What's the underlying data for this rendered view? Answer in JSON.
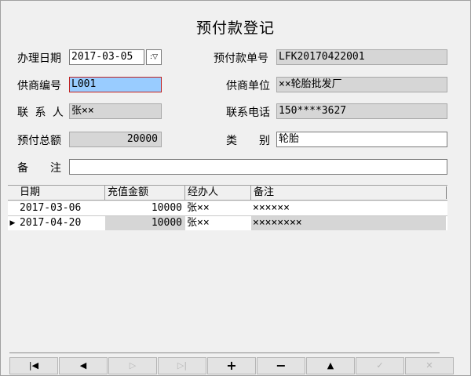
{
  "title": "预付款登记",
  "form": {
    "date_label": "办理日期",
    "date_value": "2017-03-05",
    "date_dropdown_glyph": ":",
    "prepay_no_label": "预付款单号",
    "prepay_no_value": "LFK20170422001",
    "supplier_code_label": "供商编号",
    "supplier_code_value": "L001",
    "supplier_unit_label": "供商单位",
    "supplier_unit_value": "××轮胎批发厂",
    "contact_label": "联 系 人",
    "contact_value": "张××",
    "phone_label": "联系电话",
    "phone_value": "150****3627",
    "total_label": "预付总额",
    "total_value": "20000",
    "category_label": "类　　别",
    "category_value": "轮胎",
    "remark_label": "备　　注",
    "remark_value": ""
  },
  "table": {
    "headers": [
      "日期",
      "充值金额",
      "经办人",
      "备注"
    ],
    "rows": [
      {
        "date": "2017-03-06",
        "amount": "10000",
        "handler": "张××",
        "note": "××××××",
        "current": false
      },
      {
        "date": "2017-04-20",
        "amount": "10000",
        "handler": "张××",
        "note": "××××××××",
        "current": true
      }
    ]
  },
  "nav": {
    "first_icon": "first-record-icon",
    "prev_icon": "previous-record-icon",
    "next_icon": "next-record-icon",
    "last_icon": "last-record-icon",
    "add_icon": "add-icon",
    "delete_icon": "delete-icon",
    "up_icon": "up-icon",
    "save_icon": "checkmark-icon",
    "cancel_icon": "cancel-icon"
  },
  "colors": {
    "window_bg": "#f0f0f0",
    "readonly_bg": "#d6d6d6",
    "focused_field_bg": "#99ccff",
    "focused_field_border": "#c02020"
  }
}
